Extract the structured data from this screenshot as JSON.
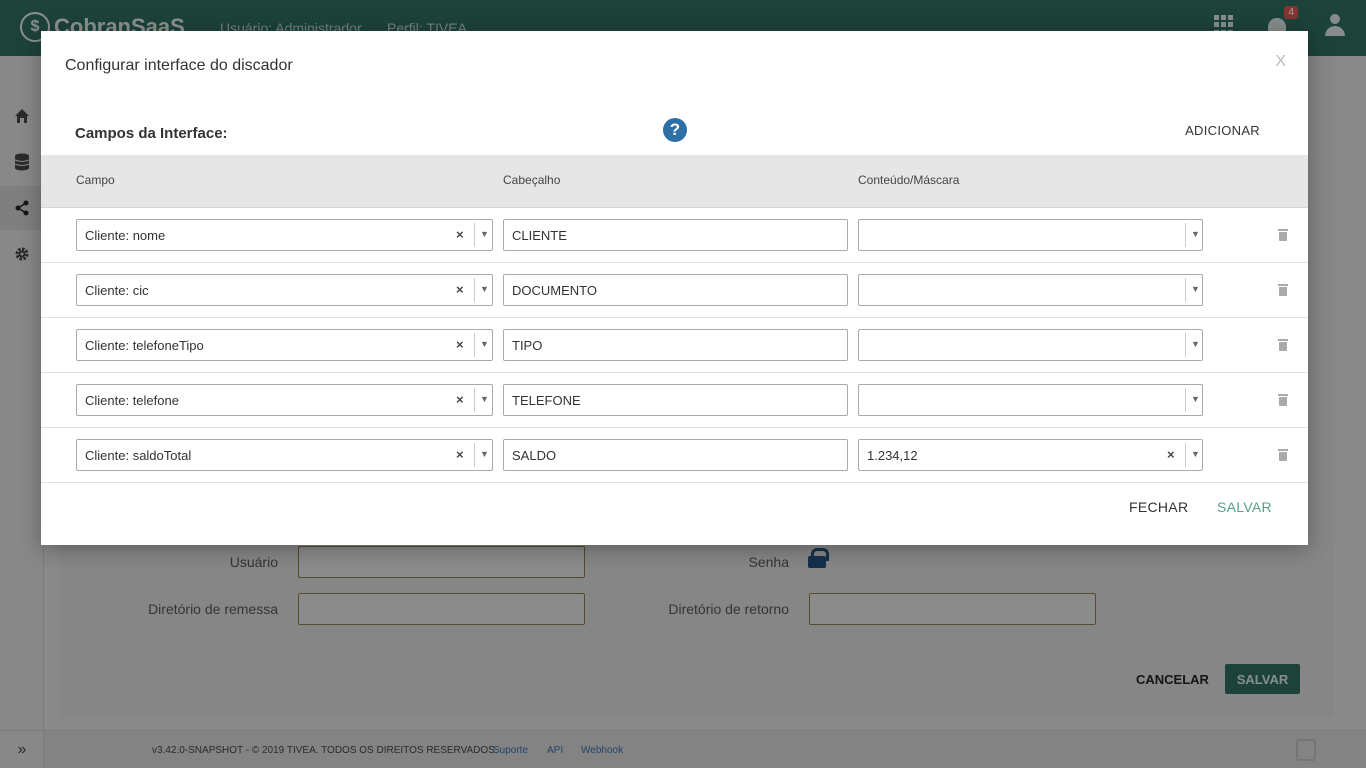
{
  "app": {
    "name": "CobranSaaS",
    "user_label": "Usuário: Administrador",
    "profile_label": "Perfil: TIVEA",
    "notifications_count": "4"
  },
  "sidebar": {
    "items": [
      {
        "icon": "home-icon"
      },
      {
        "icon": "database-icon"
      },
      {
        "icon": "share-icon"
      },
      {
        "icon": "gear-icon"
      }
    ],
    "expand_label": "»"
  },
  "background_form": {
    "user_label": "Usuário",
    "password_label": "Senha",
    "send_dir_label": "Diretório de remessa",
    "return_dir_label": "Diretório de retorno",
    "cancel_label": "CANCELAR",
    "save_label": "SALVAR"
  },
  "footer": {
    "text": "v3.42.0-SNAPSHOT - © 2019 TIVEA. TODOS OS DIREITOS RESERVADOS.",
    "links": [
      "Suporte",
      "API",
      "Webhook"
    ]
  },
  "modal": {
    "title": "Configurar interface do discador",
    "close_label": "X",
    "section_title": "Campos da Interface:",
    "help_label": "?",
    "add_label": "ADICIONAR",
    "columns": [
      "Campo",
      "Cabeçalho",
      "Conteúdo/Máscara"
    ],
    "rows": [
      {
        "field": "Cliente: nome",
        "header": "CLIENTE",
        "mask": ""
      },
      {
        "field": "Cliente: cic",
        "header": "DOCUMENTO",
        "mask": ""
      },
      {
        "field": "Cliente: telefoneTipo",
        "header": "TIPO",
        "mask": ""
      },
      {
        "field": "Cliente: telefone",
        "header": "TELEFONE",
        "mask": ""
      },
      {
        "field": "Cliente: saldoTotal",
        "header": "SALDO",
        "mask": "1.234,12"
      }
    ],
    "close_button_label": "FECHAR",
    "save_button_label": "SALVAR"
  },
  "colors": {
    "brand": "#2e6b5e",
    "accent": "#5a9e8c",
    "help": "#2f6fa8",
    "badge": "#d9534f"
  }
}
